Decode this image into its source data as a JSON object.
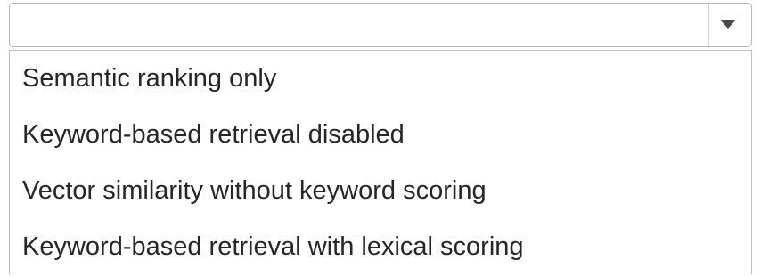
{
  "dropdown": {
    "selected_value": "",
    "arrow_icon": "chevron-down-icon",
    "options": [
      {
        "label": "Semantic ranking only"
      },
      {
        "label": "Keyword-based retrieval disabled"
      },
      {
        "label": "Vector similarity without keyword scoring"
      },
      {
        "label": "Keyword-based retrieval with lexical scoring"
      }
    ]
  }
}
